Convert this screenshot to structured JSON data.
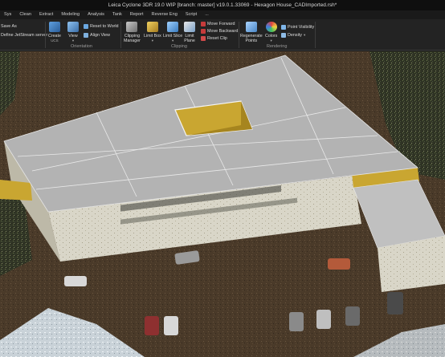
{
  "window": {
    "title": "Leica Cyclone 3DR 19.0 WIP [branch: master] v19.0.1.33069 - Hexagon House_CADImported.rsh*"
  },
  "tabs": [
    {
      "label": "Sys"
    },
    {
      "label": "Clean"
    },
    {
      "label": "Extract"
    },
    {
      "label": "Modeling"
    },
    {
      "label": "Analysis"
    },
    {
      "label": "Tank"
    },
    {
      "label": "Report"
    },
    {
      "label": "Reverse Eng"
    },
    {
      "label": "Script"
    },
    {
      "label": "..."
    }
  ],
  "ribbon": {
    "save_as": "Save As",
    "jetstream": "Define JetStream server",
    "orientation": {
      "group_label": "Orientation",
      "create_ucs": "Create",
      "create_ucs_sub": "UCS",
      "view": "View",
      "reset_to_world": "Reset to World",
      "align_view": "Align View"
    },
    "clipping": {
      "group_label": "Clipping",
      "clipping_manager_1": "Clipping",
      "clipping_manager_2": "Manager",
      "limit_box": "Limit Box",
      "limit_slice": "Limit Slice",
      "limit_plane_1": "Limit",
      "limit_plane_2": "Plane",
      "move_forward": "Move Forward",
      "move_backward": "Move Backward",
      "reset_clip": "Reset Clip"
    },
    "rendering": {
      "group_label": "Rendering",
      "regenerate_1": "Regenerate",
      "regenerate_2": "Points",
      "colors": "Colors",
      "point_visibility": "Point Visibility",
      "density": "Density"
    }
  },
  "colors": {
    "roof": "#b3b3b3",
    "opening_yellow": "#c9a631",
    "ground": "#4a3a29",
    "walls": "#d8d6c9"
  }
}
